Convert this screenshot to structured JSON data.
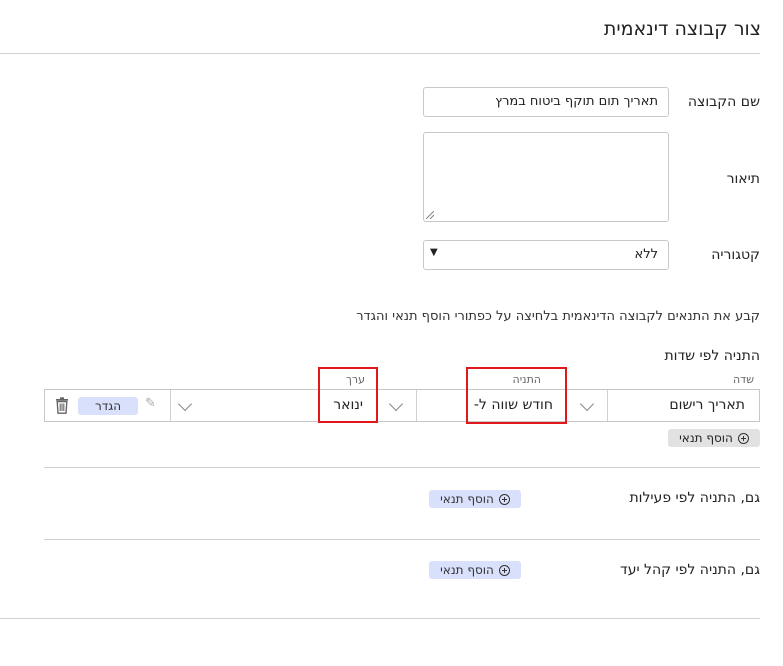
{
  "header": {
    "title": "צור קבוצה דינאמית"
  },
  "form": {
    "group_name": {
      "label": "שם הקבוצה",
      "value": "תאריך תום תוקף ביטוח במרץ"
    },
    "description": {
      "label": "תיאור",
      "value": ""
    },
    "category": {
      "label": "קטגוריה",
      "value": "ללא"
    }
  },
  "instructions": "קבע את התנאים לקבוצה הדינאמית בלחיצה על כפתורי הוסף תנאי והגדר",
  "field_conditions": {
    "title": "התניה לפי שדות",
    "headers": {
      "field": "שדה",
      "condition": "התניה",
      "value": "ערך"
    },
    "row": {
      "field": "תאריך רישום",
      "condition": "חודש שווה ל-",
      "value": "ינואר",
      "define_label": "הגדר"
    },
    "add_label": "הוסף תנאי"
  },
  "activity_conditions": {
    "label": "גם, התניה לפי פעילות",
    "add_label": "הוסף תנאי"
  },
  "audience_conditions": {
    "label": "גם, התניה לפי קהל יעד",
    "add_label": "הוסף תנאי"
  },
  "icons": [
    "chevron-down-icon",
    "pencil-icon",
    "trash-icon",
    "plus-circle-icon",
    "caret-down-icon",
    "resize-grip-icon"
  ],
  "colors": {
    "highlight": "#e0171b",
    "button_blue": "#d9e0fb",
    "button_gray": "#e2e2e2"
  }
}
